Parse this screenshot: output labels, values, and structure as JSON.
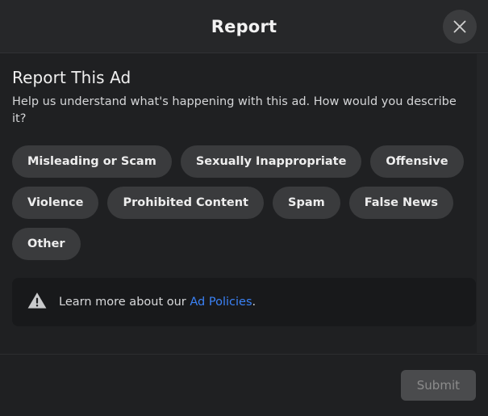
{
  "header": {
    "title": "Report",
    "close_icon": "close-icon",
    "close_label": "Close"
  },
  "main": {
    "heading": "Report This Ad",
    "description": "Help us understand what's happening with this ad. How would you describe it?",
    "reasons": [
      {
        "label": "Misleading or Scam"
      },
      {
        "label": "Sexually Inappropriate"
      },
      {
        "label": "Offensive"
      },
      {
        "label": "Violence"
      },
      {
        "label": "Prohibited Content"
      },
      {
        "label": "Spam"
      },
      {
        "label": "False News"
      },
      {
        "label": "Other"
      }
    ],
    "notice": {
      "icon": "warning-triangle-icon",
      "text_before": "Learn more about our ",
      "link_text": "Ad Policies",
      "text_after": "."
    }
  },
  "footer": {
    "submit_label": "Submit"
  },
  "colors": {
    "header_bg": "#262729",
    "body_bg": "#1f2022",
    "chip_bg": "#3a3b3d",
    "notice_bg": "#18191b",
    "link_blue": "#3b82f6",
    "submit_bg": "#4a4b4d",
    "submit_text": "#8c8c8c"
  }
}
